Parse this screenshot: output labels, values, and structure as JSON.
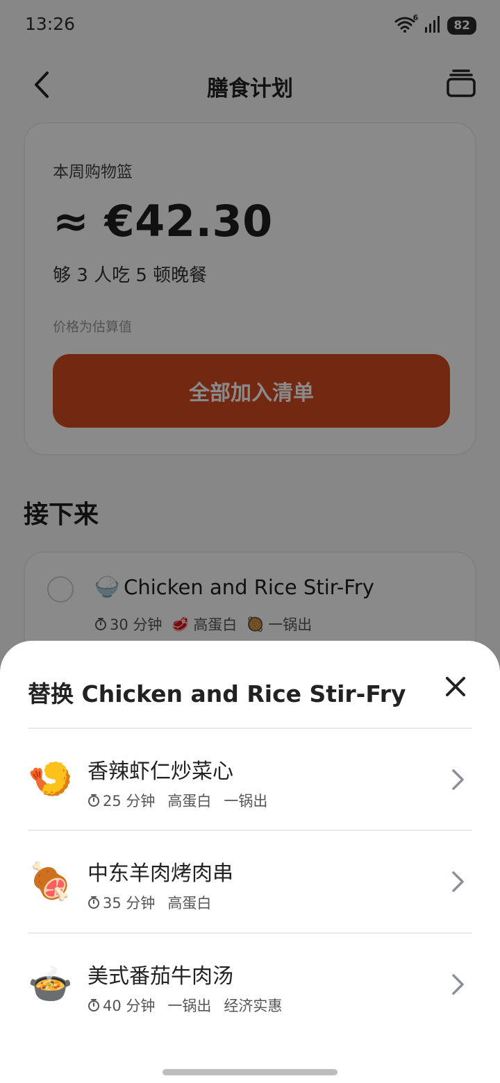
{
  "status_bar": {
    "time": "13:26",
    "network_label": "6",
    "battery": "82"
  },
  "header": {
    "title": "膳食计划",
    "back_icon": "chevron-left-icon",
    "right_icon": "cart-icon"
  },
  "basket": {
    "label": "本周购物篮",
    "price": "≈ €42.30",
    "serving": "够 3 人吃 5 顿晚餐",
    "note": "价格为估算值",
    "button_label": "全部加入清单",
    "button_color": "#d24b20"
  },
  "up_next": {
    "section_title": "接下来",
    "meal": {
      "emoji": "🍚",
      "title": "Chicken and Rice Stir-Fry",
      "time": "30 分钟",
      "tag1_emoji": "🥩",
      "tag1": "高蛋白",
      "tag2_emoji": "🥘",
      "tag2": "一锅出"
    }
  },
  "sheet": {
    "title": "替换 Chicken and Rice Stir-Fry",
    "close_icon": "close-icon",
    "alternatives": [
      {
        "emoji": "🍤",
        "name": "香辣虾仁炒菜心",
        "time": "25 分钟",
        "tags": [
          "高蛋白",
          "一锅出"
        ]
      },
      {
        "emoji": "🍖",
        "name": "中东羊肉烤肉串",
        "time": "35 分钟",
        "tags": [
          "高蛋白"
        ]
      },
      {
        "emoji": "🍲",
        "name": "美式番茄牛肉汤",
        "time": "40 分钟",
        "tags": [
          "一锅出",
          "经济实惠"
        ]
      }
    ]
  }
}
